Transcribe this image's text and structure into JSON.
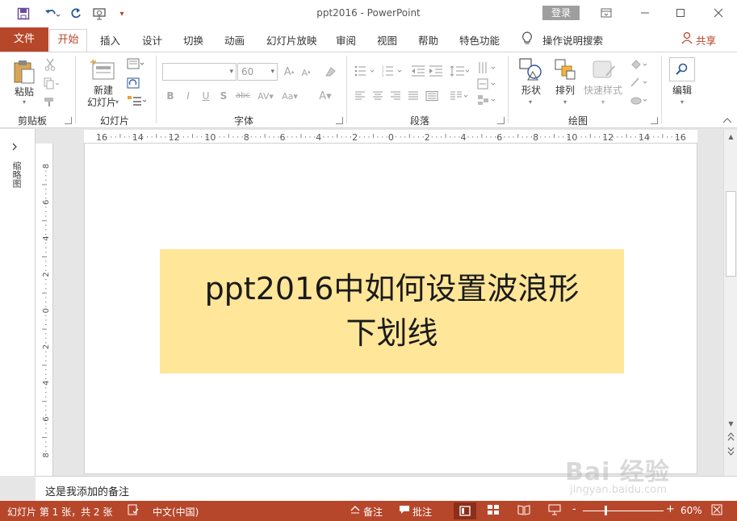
{
  "window": {
    "title": "ppt2016  -  PowerPoint",
    "login_label": "登录"
  },
  "tabs": {
    "file": "文件",
    "home": "开始",
    "insert": "插入",
    "design": "设计",
    "transitions": "切换",
    "animations": "动画",
    "slideshow": "幻灯片放映",
    "review": "审阅",
    "view": "视图",
    "help": "帮助",
    "special": "特色功能",
    "tellme": "操作说明搜索",
    "share": "共享"
  },
  "ribbon": {
    "clipboard": {
      "paste": "粘贴",
      "label": "剪贴板"
    },
    "slides": {
      "new_slide_line1": "新建",
      "new_slide_line2": "幻灯片",
      "label": "幻灯片"
    },
    "font": {
      "font_name": "",
      "font_size": "60",
      "label": "字体"
    },
    "paragraph": {
      "label": "段落"
    },
    "drawing": {
      "shapes": "形状",
      "arrange": "排列",
      "quick_styles": "快速样式",
      "label": "绘图"
    },
    "editing": {
      "edit": "编辑"
    }
  },
  "left_pane": {
    "label": "缩略图"
  },
  "ruler": {
    "horizontal_ticks": [
      "16",
      "14",
      "12",
      "10",
      "8",
      "6",
      "4",
      "2",
      "0",
      "2",
      "4",
      "6",
      "8",
      "10",
      "12",
      "14",
      "16"
    ],
    "vertical_ticks": [
      "8",
      "6",
      "4",
      "2",
      "0",
      "2",
      "4",
      "6",
      "8"
    ]
  },
  "slide": {
    "text_line1": "ppt2016中如何设置波浪形",
    "text_line2": "下划线",
    "textbox_fill": "#ffe699"
  },
  "notes": {
    "text": "这是我添加的备注"
  },
  "status": {
    "slide_info": "幻灯片 第 1 张，共 2 张",
    "language": "中文(中国)",
    "notes_btn": "备注",
    "comments_btn": "批注",
    "zoom": "60%",
    "zoom_minus": "-",
    "zoom_plus": "+"
  },
  "watermark": {
    "brand": "Bai 经验",
    "url": "jingyan.baidu.com"
  },
  "colors": {
    "accent": "#b7472a",
    "status_dark": "#8a2f1c",
    "workspace": "#e6e6e6"
  }
}
